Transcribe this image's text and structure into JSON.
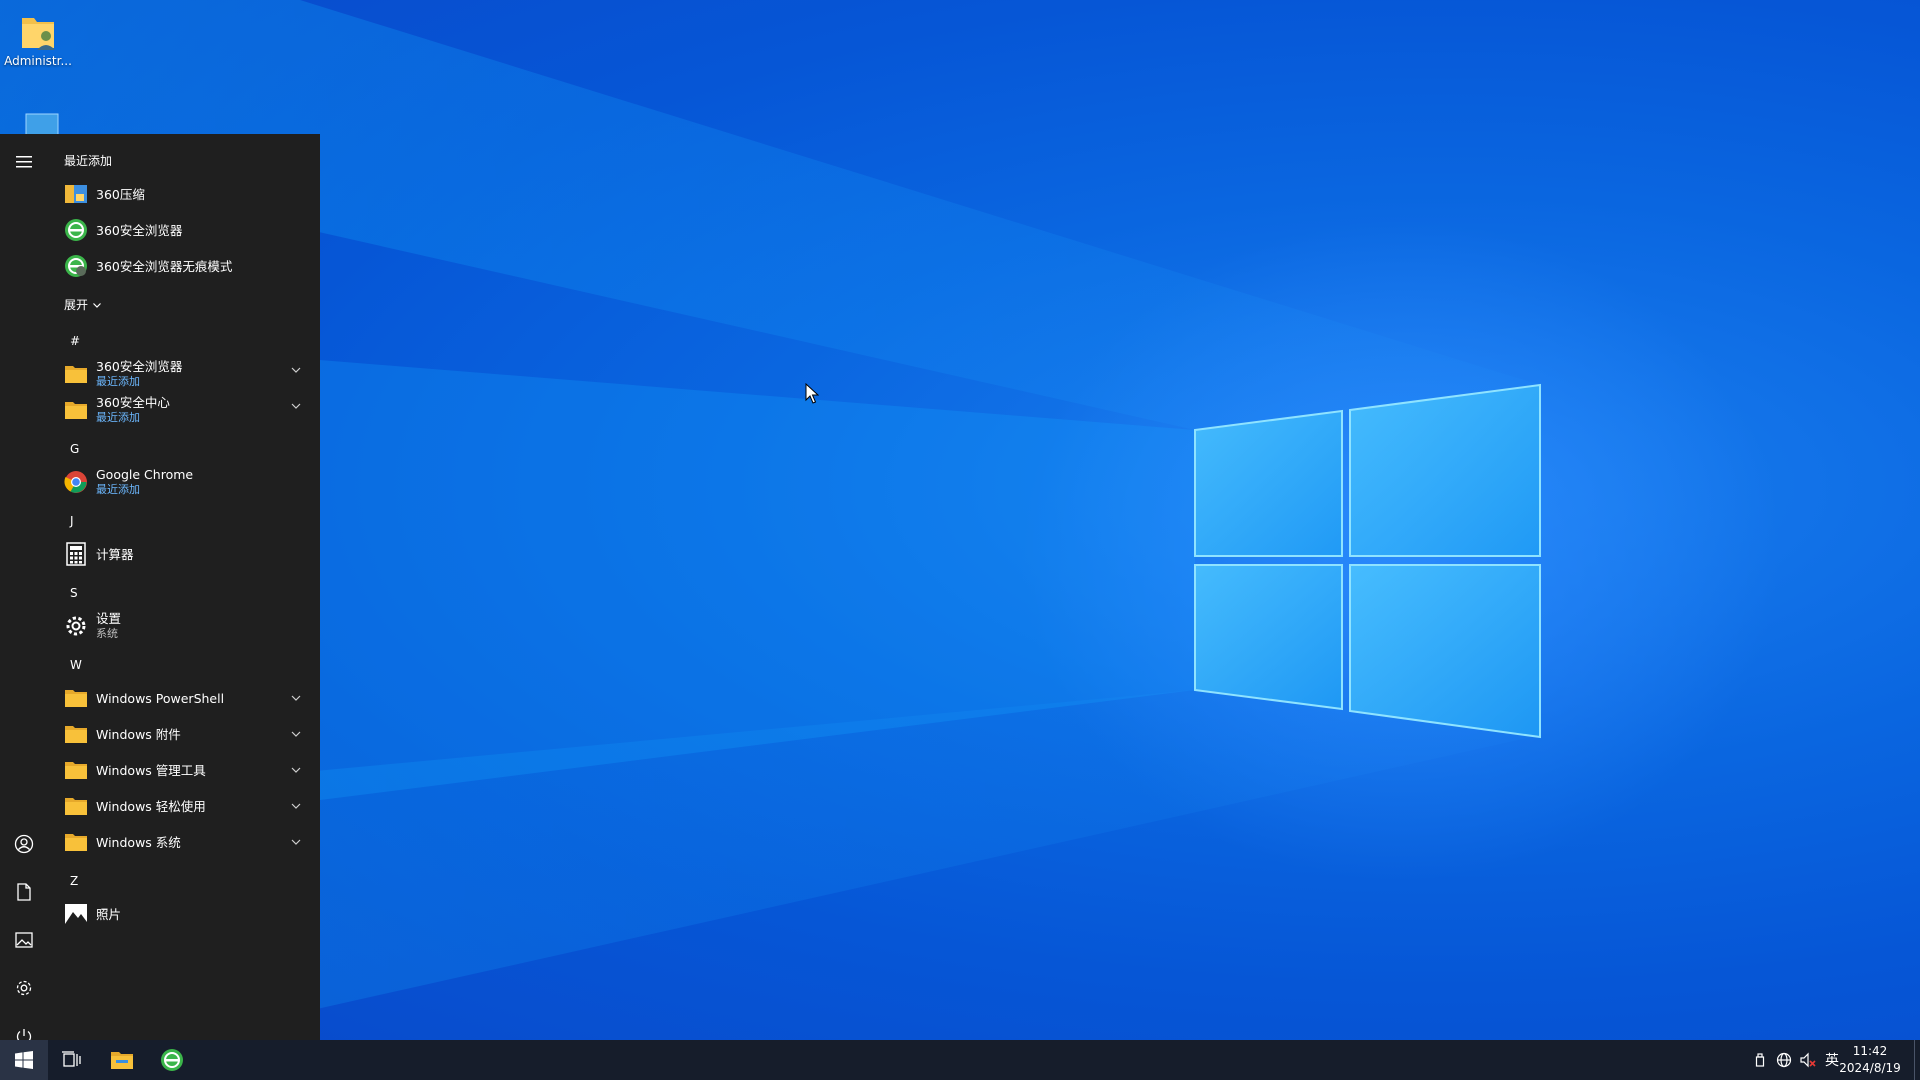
{
  "desktop": {
    "icons": [
      {
        "label": "Administr...",
        "icon": "user-folder-icon"
      },
      {
        "label": "",
        "icon": "computer-icon"
      }
    ]
  },
  "start_menu": {
    "recently_added_title": "最近添加",
    "recent_items": [
      {
        "name": "360压缩",
        "icon": "360zip-icon"
      },
      {
        "name": "360安全浏览器",
        "icon": "360browser-icon"
      },
      {
        "name": "360安全浏览器无痕模式",
        "icon": "360browser-private-icon"
      }
    ],
    "expand_label": "展开",
    "groups": [
      {
        "letter": "#"
      },
      {
        "letter": "G"
      },
      {
        "letter": "J"
      },
      {
        "letter": "S"
      },
      {
        "letter": "W"
      },
      {
        "letter": "Z"
      }
    ],
    "apps": [
      {
        "name": "360安全浏览器",
        "sub": "最近添加",
        "icon": "folder-icon",
        "expandable": true
      },
      {
        "name": "360安全中心",
        "sub": "最近添加",
        "icon": "folder-icon",
        "expandable": true
      },
      {
        "name": "Google Chrome",
        "sub": "最近添加",
        "icon": "chrome-icon",
        "expandable": false
      },
      {
        "name": "计算器",
        "sub": "",
        "icon": "calculator-icon",
        "expandable": false
      },
      {
        "name": "设置",
        "sub": "系统",
        "icon": "settings-icon",
        "expandable": false
      },
      {
        "name": "Windows PowerShell",
        "sub": "",
        "icon": "folder-icon",
        "expandable": true
      },
      {
        "name": "Windows 附件",
        "sub": "",
        "icon": "folder-icon",
        "expandable": true
      },
      {
        "name": "Windows 管理工具",
        "sub": "",
        "icon": "folder-icon",
        "expandable": true
      },
      {
        "name": "Windows 轻松使用",
        "sub": "",
        "icon": "folder-icon",
        "expandable": true
      },
      {
        "name": "Windows 系统",
        "sub": "",
        "icon": "folder-icon",
        "expandable": true
      },
      {
        "name": "照片",
        "sub": "",
        "icon": "photos-icon",
        "expandable": false
      }
    ],
    "rail": [
      "hamburger-icon",
      "user-icon",
      "documents-icon",
      "pictures-icon",
      "settings-icon",
      "power-icon"
    ]
  },
  "taskbar": {
    "buttons": [
      "windows-start-icon",
      "task-view-icon",
      "file-explorer-icon",
      "360browser-icon"
    ],
    "tray": {
      "icons": [
        "usb-device-icon",
        "network-icon",
        "volume-muted-icon"
      ],
      "ime_label": "英",
      "time": "11:42",
      "date": "2024/8/19"
    }
  },
  "colors": {
    "desktop_blue": "#0a66e0",
    "start_bg": "#1f1f1f",
    "taskbar_bg": "#161d2b",
    "link_blue": "#6cb8ff",
    "folder_yellow": "#f8c13a"
  }
}
